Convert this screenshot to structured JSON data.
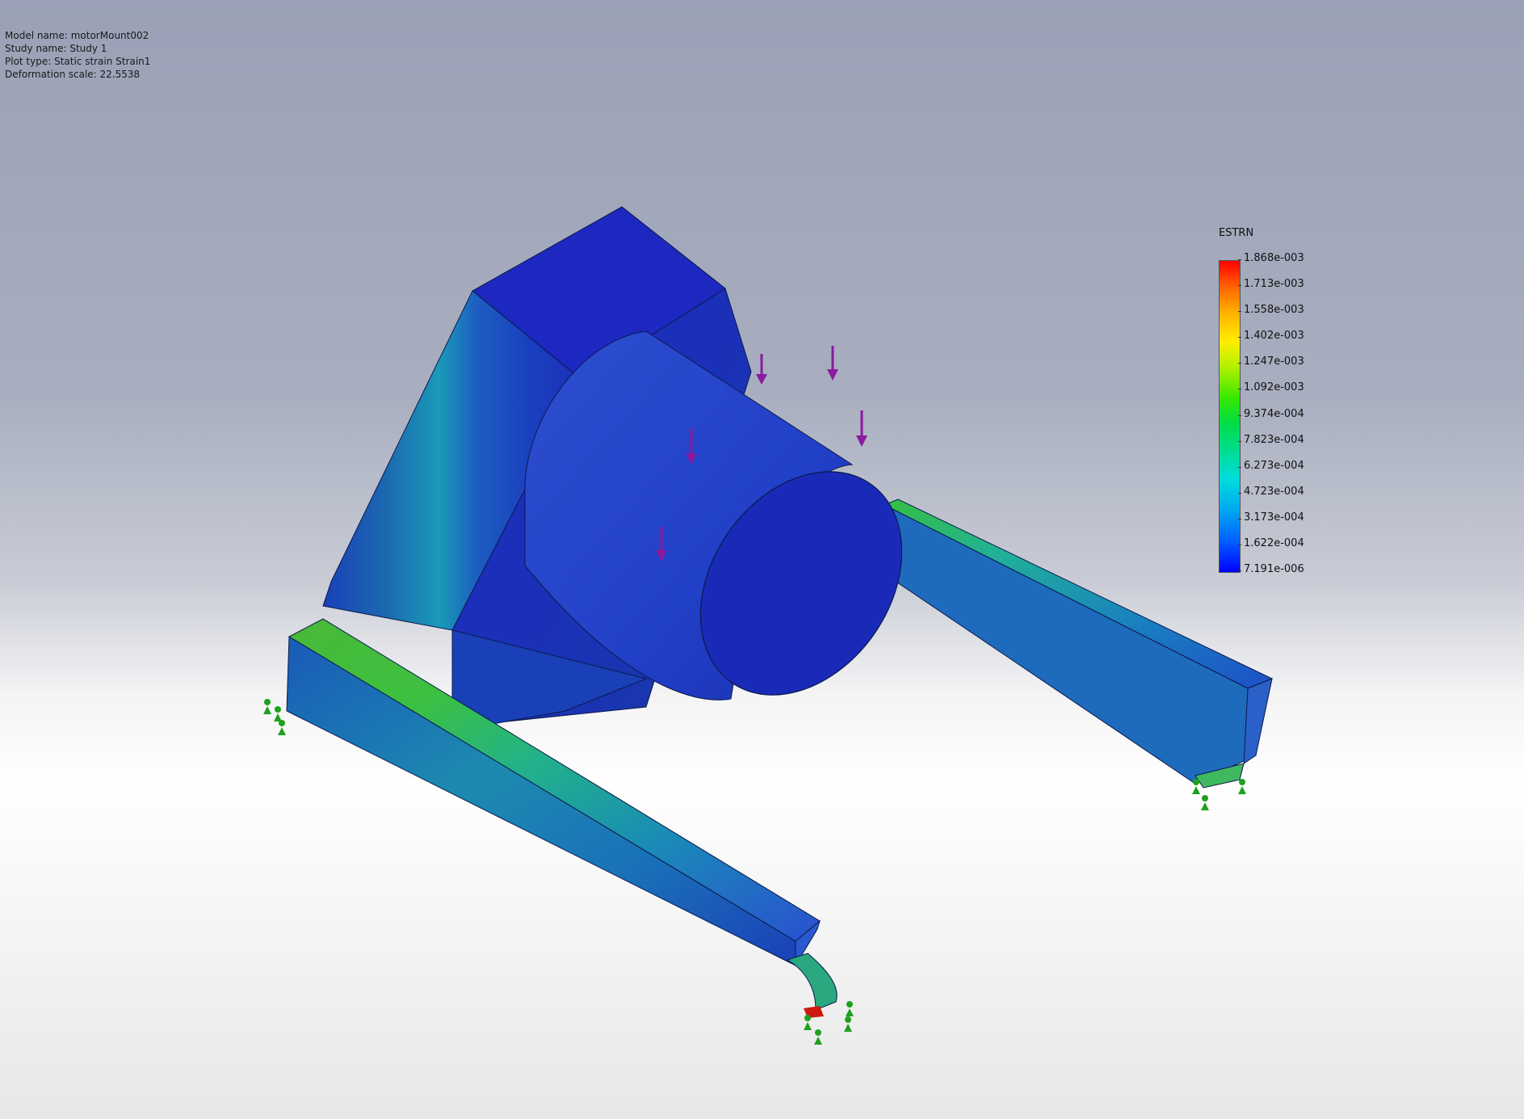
{
  "info": {
    "model_name": "Model name: motorMount002",
    "study_name": "Study name: Study 1",
    "plot_type": "Plot type: Static strain Strain1",
    "deformation_scale": "Deformation scale: 22.5538"
  },
  "legend": {
    "title": "ESTRN",
    "values": [
      "1.868e-003",
      "1.713e-003",
      "1.558e-003",
      "1.402e-003",
      "1.247e-003",
      "1.092e-003",
      "9.374e-004",
      "7.823e-004",
      "6.273e-004",
      "4.723e-004",
      "3.173e-004",
      "1.622e-004",
      "7.191e-006"
    ],
    "color_max": "#ff0000",
    "color_min": "#0000ff"
  },
  "colors": {
    "load_arrow": "#8a1aa0",
    "fixture": "#1fa01f",
    "mount_body": "#1a2bb8",
    "cylinder": "#2238c8"
  }
}
